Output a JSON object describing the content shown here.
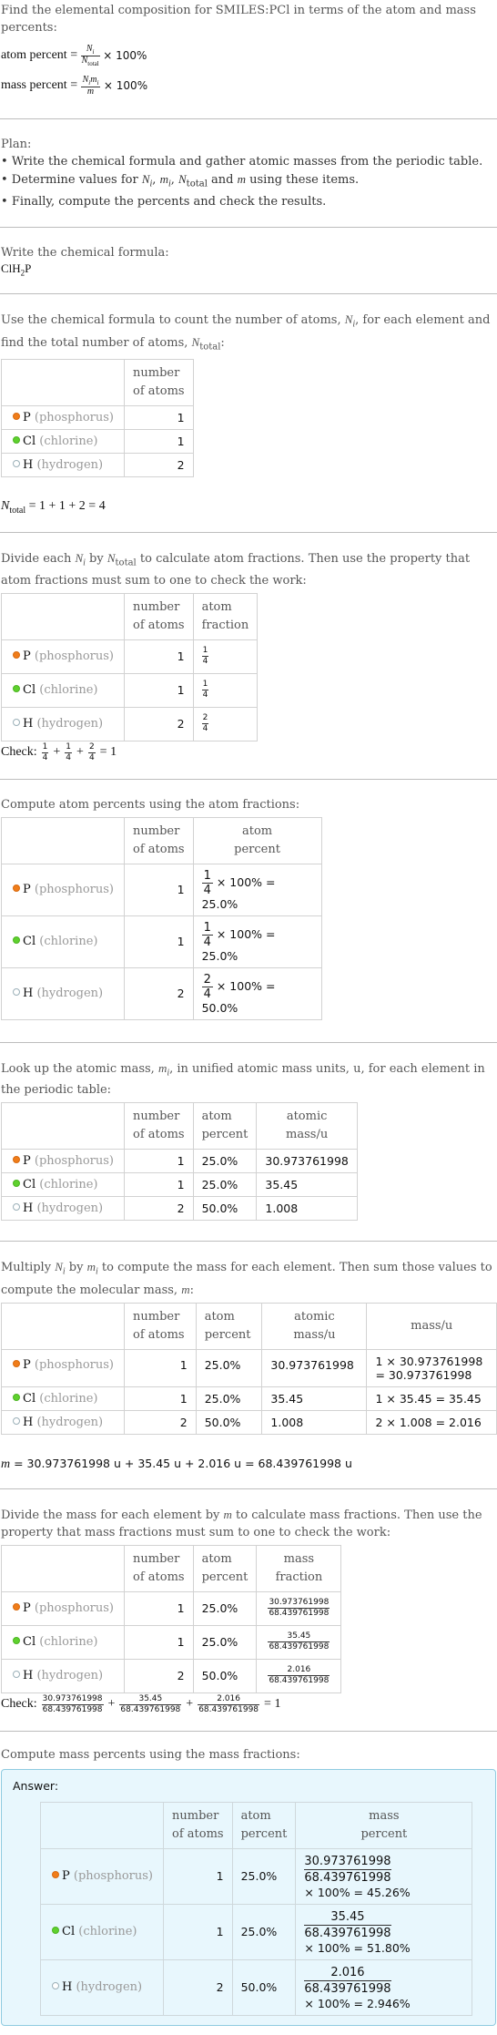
{
  "intro": {
    "title_line": "Find the elemental composition for SMILES:PCl in terms of the atom and mass percents:",
    "atom_percent_label": "atom percent",
    "mass_percent_label": "mass percent",
    "atom_formula": {
      "num": "N_i",
      "den": "N_total",
      "tail": "× 100%"
    },
    "mass_formula": {
      "num": "N_i m_i",
      "den": "m",
      "tail": "× 100%"
    }
  },
  "plan": {
    "heading": "Plan:",
    "items": [
      "Write the chemical formula and gather atomic masses from the periodic table.",
      "Determine values for N_i, m_i, N_total and m using these items.",
      "Finally, compute the percents and check the results."
    ]
  },
  "formula_section": {
    "heading": "Write the chemical formula:",
    "formula": "ClH2P"
  },
  "elements": [
    {
      "symbol": "P",
      "name": "(phosphorus)",
      "color": "#f07d1a",
      "border": "#d86a10",
      "count": "1",
      "fraction": [
        "1",
        "4"
      ],
      "atom_percent": "25.0%",
      "atomic_mass": "30.973761998",
      "mass_line1": "1 × 30.973761998",
      "mass_line2": "= 30.973761998",
      "mass_num": "30.973761998",
      "mass_percent": "× 100% = 45.26%",
      "atom_percent_calc": "× 100% = 25.0%"
    },
    {
      "symbol": "Cl",
      "name": "(chlorine)",
      "color": "#5fd12e",
      "border": "#4cb522",
      "count": "1",
      "fraction": [
        "1",
        "4"
      ],
      "atom_percent": "25.0%",
      "atomic_mass": "35.45",
      "mass_line1": "1 × 35.45 = 35.45",
      "mass_line2": "",
      "mass_num": "35.45",
      "mass_percent": "× 100% = 51.80%",
      "atom_percent_calc": "× 100% = 25.0%"
    },
    {
      "symbol": "H",
      "name": "(hydrogen)",
      "color": "#ffffff",
      "border": "#9bb0b8",
      "count": "2",
      "fraction": [
        "2",
        "4"
      ],
      "atom_percent": "50.0%",
      "atomic_mass": "1.008",
      "mass_line1": "2 × 1.008 = 2.016",
      "mass_line2": "",
      "mass_num": "2.016",
      "mass_percent": "× 100% = 2.946%",
      "atom_percent_calc": "× 100% = 50.0%"
    }
  ],
  "headers": {
    "number_of_atoms": [
      "number",
      "of atoms"
    ],
    "atom_fraction": [
      "atom",
      "fraction"
    ],
    "atom_percent": [
      "atom",
      "percent"
    ],
    "atomic_mass": [
      "atomic",
      "mass/u"
    ],
    "mass": "mass/u",
    "mass_fraction": [
      "mass",
      "fraction"
    ],
    "mass_percent": [
      "mass",
      "percent"
    ]
  },
  "count_section": {
    "text": "Use the chemical formula to count the number of atoms, N_i, for each element and find the total number of atoms, N_total:",
    "total_line": "= 1 + 1 + 2 = 4"
  },
  "fraction_section": {
    "text": "Divide each N_i by N_total to calculate atom fractions. Then use the property that atom fractions must sum to one to check the work:",
    "check_label": "Check:",
    "check_result": "= 1"
  },
  "atom_percent_section": {
    "text": "Compute atom percents using the atom fractions:"
  },
  "mass_lookup_section": {
    "text": "Look up the atomic mass, m_i, in unified atomic mass units, u, for each element in the periodic table:"
  },
  "mass_section": {
    "text": "Multiply N_i by m_i to compute the mass for each element. Then sum those values to compute the molecular mass, m:",
    "total_line": "= 30.973761998 u + 35.45 u + 2.016 u = 68.439761998 u"
  },
  "mass_fraction_section": {
    "text": "Divide the mass for each element by m to calculate mass fractions. Then use the property that mass fractions must sum to one to check the work:",
    "denominator": "68.439761998",
    "check_label": "Check:",
    "check_result": "= 1"
  },
  "mass_percent_section": {
    "text": "Compute mass percents using the mass fractions:",
    "answer_label": "Answer:"
  }
}
